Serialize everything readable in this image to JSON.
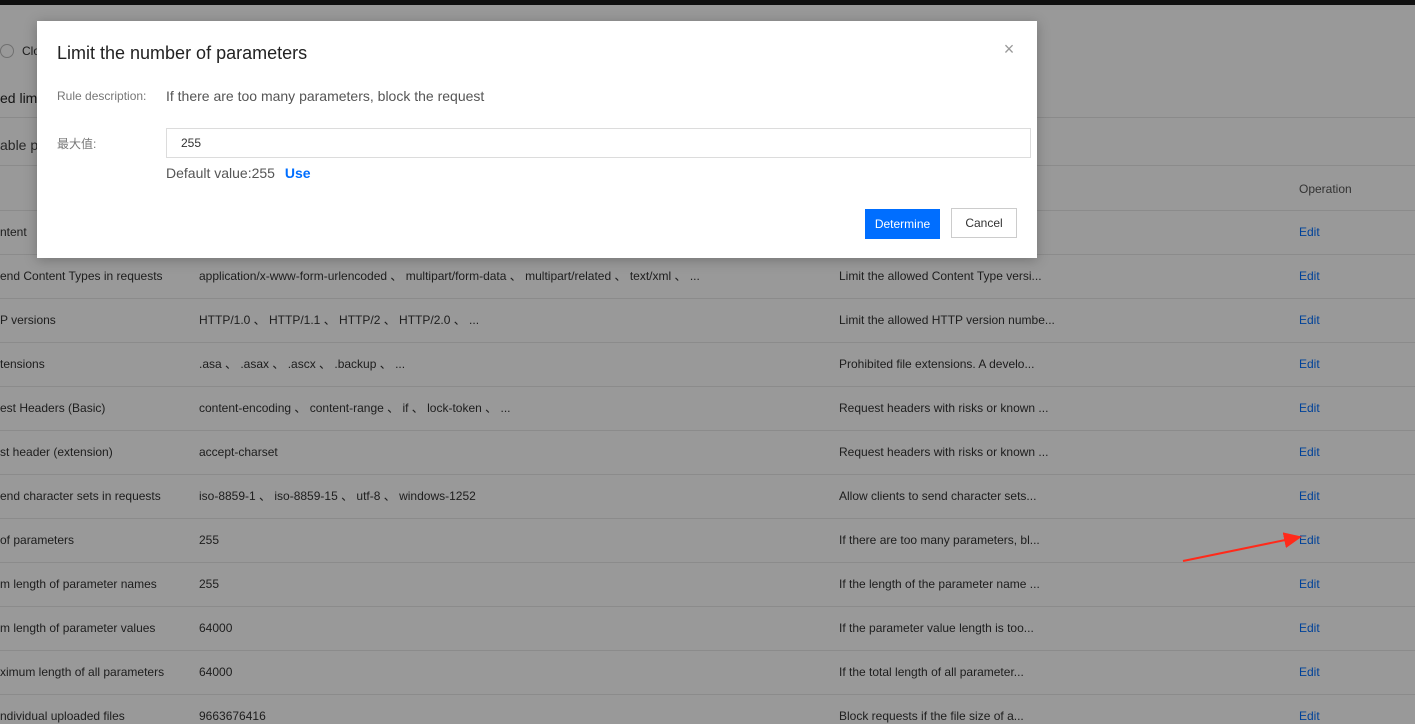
{
  "background": {
    "radio_label": "Clo",
    "section_title": "ed lim",
    "sub_title": "able pa",
    "operation_header": "Operation",
    "rows": [
      {
        "name": "ntent",
        "value": "",
        "desc": "",
        "op": "Edit"
      },
      {
        "name": "end Content Types in requests",
        "value": "application/x-www-form-urlencoded 、 multipart/form-data 、 multipart/related 、 text/xml 、 ...",
        "desc": "Limit the allowed Content Type versi...",
        "op": "Edit"
      },
      {
        "name": "P versions",
        "value": "HTTP/1.0 、 HTTP/1.1 、 HTTP/2 、 HTTP/2.0 、 ...",
        "desc": "Limit the allowed HTTP version numbe...",
        "op": "Edit"
      },
      {
        "name": "tensions",
        "value": ".asa 、 .asax 、 .ascx 、 .backup 、 ...",
        "desc": "Prohibited file extensions. A develo...",
        "op": "Edit"
      },
      {
        "name": "est Headers (Basic)",
        "value": "content-encoding 、 content-range 、 if 、 lock-token 、 ...",
        "desc": "Request headers with risks or known ...",
        "op": "Edit"
      },
      {
        "name": "st header (extension)",
        "value": "accept-charset",
        "desc": "Request headers with risks or known ...",
        "op": "Edit"
      },
      {
        "name": "end character sets in requests",
        "value": "iso-8859-1 、 iso-8859-15 、 utf-8 、 windows-1252",
        "desc": "Allow clients to send character sets...",
        "op": "Edit"
      },
      {
        "name": "of parameters",
        "value": "255",
        "desc": "If there are too many parameters, bl...",
        "op": "Edit"
      },
      {
        "name": "m length of parameter names",
        "value": "255",
        "desc": "If the length of the parameter name ...",
        "op": "Edit"
      },
      {
        "name": "m length of parameter values",
        "value": "64000",
        "desc": "If the parameter value length is too...",
        "op": "Edit"
      },
      {
        "name": "ximum length of all parameters",
        "value": "64000",
        "desc": "If the total length of all parameter...",
        "op": "Edit"
      },
      {
        "name": "ndividual uploaded files",
        "value": "9663676416",
        "desc": "Block requests if the file size of a...",
        "op": "Edit"
      }
    ]
  },
  "dialog": {
    "title": "Limit the number of parameters",
    "rule_desc_label": "Rule description:",
    "rule_desc_value": "If there are too many parameters, block the request",
    "max_label": "最大值:",
    "max_value": "255",
    "default_text": "Default value:255",
    "use_label": "Use",
    "determine_label": "Determine",
    "cancel_label": "Cancel"
  },
  "colors": {
    "accent": "#006eff",
    "annotation_arrow": "#ff2a1a"
  }
}
